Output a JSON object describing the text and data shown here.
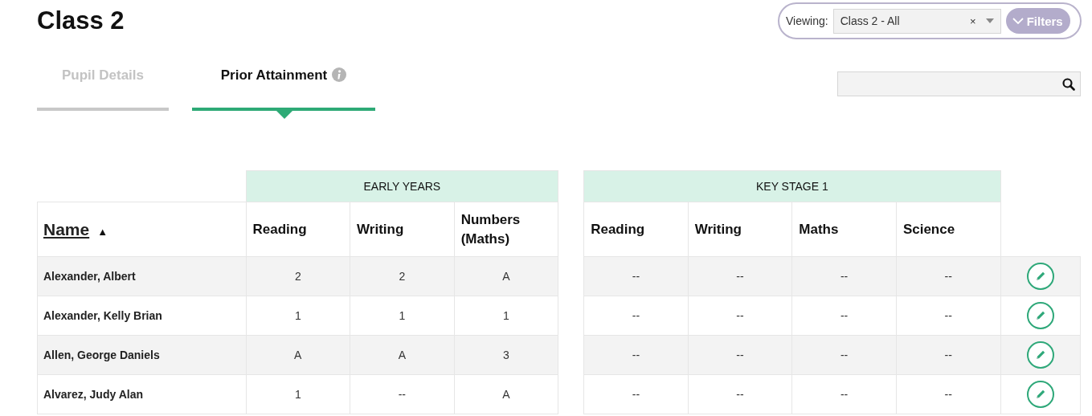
{
  "page_title": "Class 2",
  "viewing": {
    "label": "Viewing:",
    "value": "Class 2 - All",
    "clear": "×"
  },
  "filters_button": "Filters",
  "tabs": [
    {
      "label": "Pupil Details",
      "selected": false,
      "info": false
    },
    {
      "label": "Prior Attainment",
      "selected": true,
      "info": true
    }
  ],
  "table": {
    "name_column": {
      "label": "Name",
      "sort_indicator": "▲"
    },
    "groups": [
      {
        "label": "EARLY YEARS",
        "columns": [
          "Reading",
          "Writing",
          "Numbers (Maths)"
        ]
      },
      {
        "label": "KEY STAGE 1",
        "columns": [
          "Reading",
          "Writing",
          "Maths",
          "Science"
        ]
      }
    ],
    "rows": [
      {
        "name": "Alexander, Albert",
        "values": [
          "2",
          "2",
          "A",
          "--",
          "--",
          "--",
          "--"
        ]
      },
      {
        "name": "Alexander, Kelly Brian",
        "values": [
          "1",
          "1",
          "1",
          "--",
          "--",
          "--",
          "--"
        ]
      },
      {
        "name": "Allen, George Daniels",
        "values": [
          "A",
          "A",
          "3",
          "--",
          "--",
          "--",
          "--"
        ]
      },
      {
        "name": "Alvarez, Judy Alan",
        "values": [
          "1",
          "--",
          "A",
          "--",
          "--",
          "--",
          "--"
        ]
      }
    ]
  }
}
